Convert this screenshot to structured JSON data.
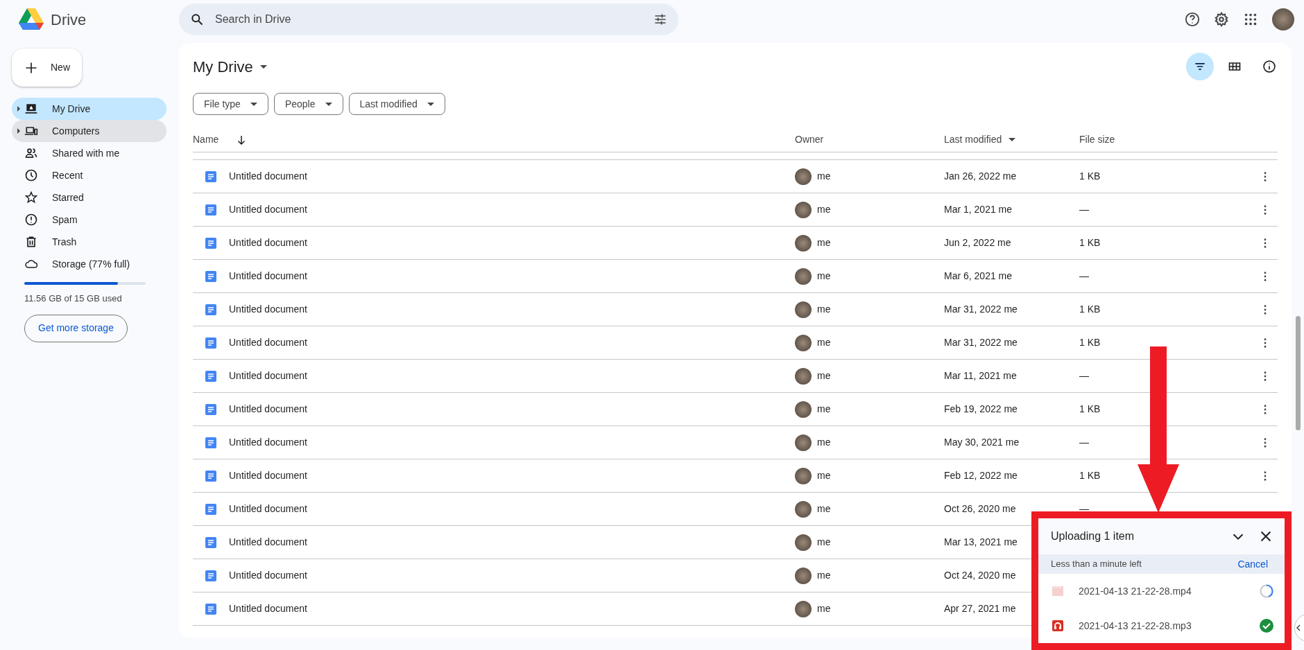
{
  "app": {
    "name": "Drive"
  },
  "search": {
    "placeholder": "Search in Drive"
  },
  "new_button": "New",
  "sidebar": {
    "items": [
      {
        "kind": "drive",
        "label": "My Drive",
        "selected": true,
        "hovered": false,
        "expandable": true
      },
      {
        "kind": "computers",
        "label": "Computers",
        "selected": false,
        "hovered": true,
        "expandable": true
      },
      {
        "kind": "shared",
        "label": "Shared with me",
        "selected": false,
        "hovered": false,
        "expandable": false
      },
      {
        "kind": "recent",
        "label": "Recent",
        "selected": false,
        "hovered": false,
        "expandable": false
      },
      {
        "kind": "starred",
        "label": "Starred",
        "selected": false,
        "hovered": false,
        "expandable": false
      },
      {
        "kind": "spam",
        "label": "Spam",
        "selected": false,
        "hovered": false,
        "expandable": false
      },
      {
        "kind": "trash",
        "label": "Trash",
        "selected": false,
        "hovered": false,
        "expandable": false
      },
      {
        "kind": "storage",
        "label": "Storage (77% full)",
        "selected": false,
        "hovered": false,
        "expandable": false
      }
    ],
    "storage": {
      "level": 0.77,
      "usage": "11.56 GB of 15 GB used",
      "button": "Get more storage"
    }
  },
  "main": {
    "title": "My Drive",
    "filters": [
      "File type",
      "People",
      "Last modified"
    ],
    "filter_view_selected": true
  },
  "table": {
    "columns": [
      {
        "label": "Name",
        "kind": "sorted"
      },
      {
        "label": "Owner",
        "kind": "plain"
      },
      {
        "label": "Last modified",
        "kind": "dropdown"
      },
      {
        "label": "File size",
        "kind": "plain"
      }
    ],
    "rows": [
      {
        "name": "Untitled document",
        "owner": "me",
        "modified": "Jan 26, 2022 me",
        "file_size": "1 KB",
        "menu": true
      },
      {
        "name": "Untitled document",
        "owner": "me",
        "modified": "Mar 1, 2021 me",
        "file_size": "—",
        "menu": true
      },
      {
        "name": "Untitled document",
        "owner": "me",
        "modified": "Jun 2, 2022 me",
        "file_size": "1 KB",
        "menu": true
      },
      {
        "name": "Untitled document",
        "owner": "me",
        "modified": "Mar 6, 2021 me",
        "file_size": "—",
        "menu": true
      },
      {
        "name": "Untitled document",
        "owner": "me",
        "modified": "Mar 31, 2022 me",
        "file_size": "1 KB",
        "menu": true
      },
      {
        "name": "Untitled document",
        "owner": "me",
        "modified": "Mar 31, 2022 me",
        "file_size": "1 KB",
        "menu": true
      },
      {
        "name": "Untitled document",
        "owner": "me",
        "modified": "Mar 11, 2021 me",
        "file_size": "—",
        "menu": true
      },
      {
        "name": "Untitled document",
        "owner": "me",
        "modified": "Feb 19, 2022 me",
        "file_size": "1 KB",
        "menu": true
      },
      {
        "name": "Untitled document",
        "owner": "me",
        "modified": "May 30, 2021 me",
        "file_size": "—",
        "menu": true
      },
      {
        "name": "Untitled document",
        "owner": "me",
        "modified": "Feb 12, 2022 me",
        "file_size": "1 KB",
        "menu": true
      },
      {
        "name": "Untitled document",
        "owner": "me",
        "modified": "Oct 26, 2020 me",
        "file_size": "—",
        "menu": false
      },
      {
        "name": "Untitled document",
        "owner": "me",
        "modified": "Mar 13, 2021 me",
        "menu": false
      },
      {
        "name": "Untitled document",
        "owner": "me",
        "modified": "Oct 24, 2020 me",
        "menu": false
      },
      {
        "name": "Untitled document",
        "owner": "me",
        "modified": "Apr 27, 2021 me",
        "menu": false
      }
    ]
  },
  "upload_panel": {
    "title": "Uploading 1 item",
    "status": "Less than a minute left",
    "cancel": "Cancel",
    "items": [
      {
        "kind": "video",
        "name": "2021-04-13 21-22-28.mp4",
        "done": false
      },
      {
        "kind": "audio",
        "name": "2021-04-13 21-22-28.mp3",
        "done": true
      }
    ]
  }
}
